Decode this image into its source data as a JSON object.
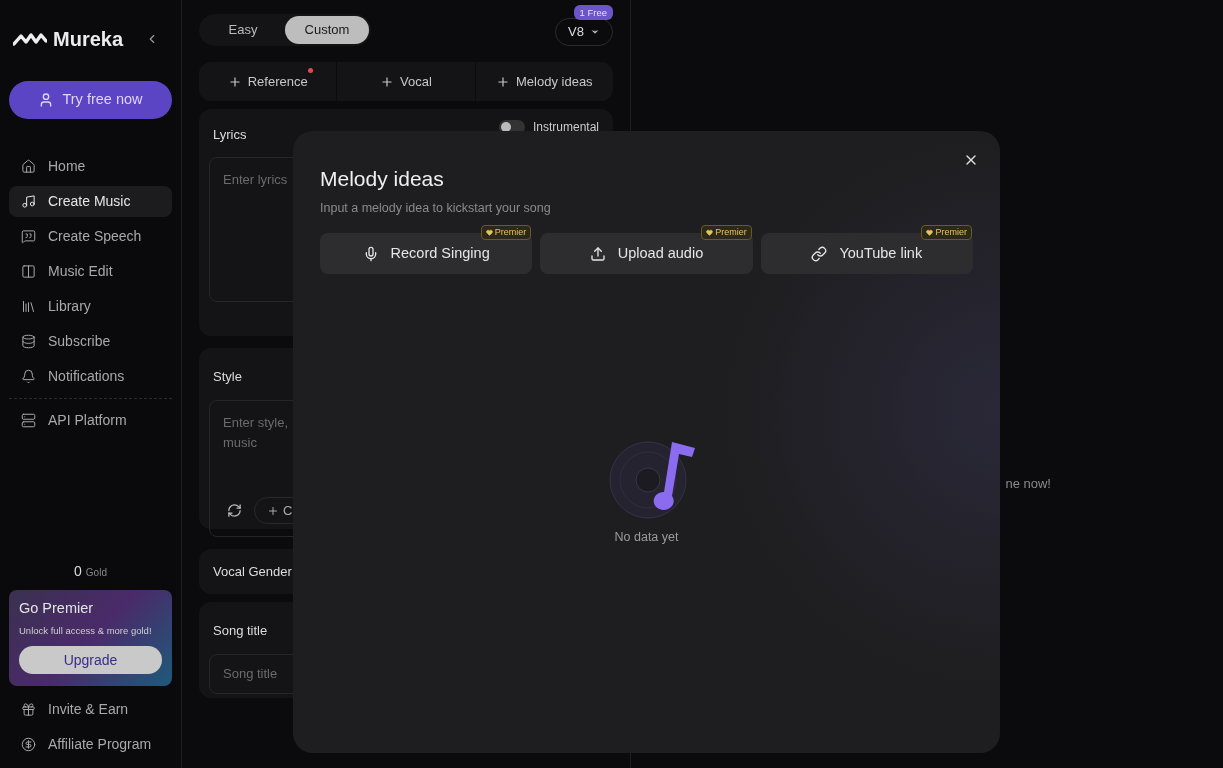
{
  "logo": {
    "text": "Mureka"
  },
  "try_button": {
    "label": "Try free now"
  },
  "nav_items": [
    {
      "label": "Home",
      "selected": false
    },
    {
      "label": "Create Music",
      "selected": true
    },
    {
      "label": "Create Speech",
      "selected": false
    },
    {
      "label": "Music Edit",
      "selected": false
    },
    {
      "label": "Library",
      "selected": false
    },
    {
      "label": "Subscribe",
      "selected": false
    },
    {
      "label": "Notifications",
      "selected": false
    }
  ],
  "nav_extra": [
    {
      "label": "API Platform",
      "selected": false
    }
  ],
  "gold": {
    "amount": "0",
    "unit": "Gold"
  },
  "premier_card": {
    "title": "Go Premier",
    "subtitle": "Unlock full access & more gold!",
    "button": "Upgrade"
  },
  "footer_items": [
    {
      "label": "Invite & Earn"
    },
    {
      "label": "Affiliate Program"
    }
  ],
  "mode_tabs": [
    {
      "label": "Easy",
      "selected": false
    },
    {
      "label": "Custom",
      "selected": true
    }
  ],
  "model": {
    "label": "V8",
    "badge": "1 Free"
  },
  "add_buttons": [
    {
      "label": "Reference",
      "dot": true
    },
    {
      "label": "Vocal",
      "dot": false
    },
    {
      "label": "Melody ideas",
      "dot": false
    }
  ],
  "lyrics": {
    "title": "Lyrics",
    "placeholder": "Enter lyrics",
    "instrumental": {
      "label": "Instrumental",
      "on": false
    }
  },
  "style": {
    "title": "Style",
    "placeholder": "Enter style, music",
    "tag_button": "C"
  },
  "vocal_gender": {
    "title": "Vocal Gender"
  },
  "song_title": {
    "title": "Song title",
    "placeholder": "Song title"
  },
  "right_hint": "ne now!",
  "modal": {
    "title": "Melody ideas",
    "subtitle": "Input a melody idea to kickstart your song",
    "options": [
      {
        "label": "Record Singing",
        "badge": "Premier"
      },
      {
        "label": "Upload audio",
        "badge": "Premier"
      },
      {
        "label": "YouTube link",
        "badge": "Premier"
      }
    ],
    "empty_text": "No data yet"
  }
}
